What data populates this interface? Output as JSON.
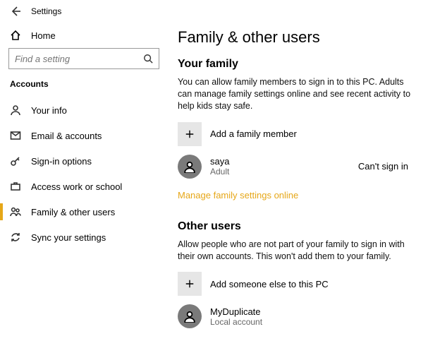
{
  "window": {
    "title": "Settings"
  },
  "home": {
    "label": "Home"
  },
  "search": {
    "placeholder": "Find a setting"
  },
  "section": "Accounts",
  "nav": [
    {
      "label": "Your info"
    },
    {
      "label": "Email & accounts"
    },
    {
      "label": "Sign-in options"
    },
    {
      "label": "Access work or school"
    },
    {
      "label": "Family & other users"
    },
    {
      "label": "Sync your settings"
    }
  ],
  "page": {
    "title": "Family & other users",
    "family": {
      "heading": "Your family",
      "desc": "You can allow family members to sign in to this PC. Adults can manage family settings online and see recent activity to help kids stay safe.",
      "add_label": "Add a family member",
      "member": {
        "name": "saya",
        "role": "Adult",
        "status": "Can't sign in"
      },
      "manage_link": "Manage family settings online"
    },
    "other": {
      "heading": "Other users",
      "desc": "Allow people who are not part of your family to sign in with their own accounts. This won't add them to your family.",
      "add_label": "Add someone else to this PC",
      "member": {
        "name": "MyDuplicate",
        "type": "Local account"
      }
    }
  }
}
